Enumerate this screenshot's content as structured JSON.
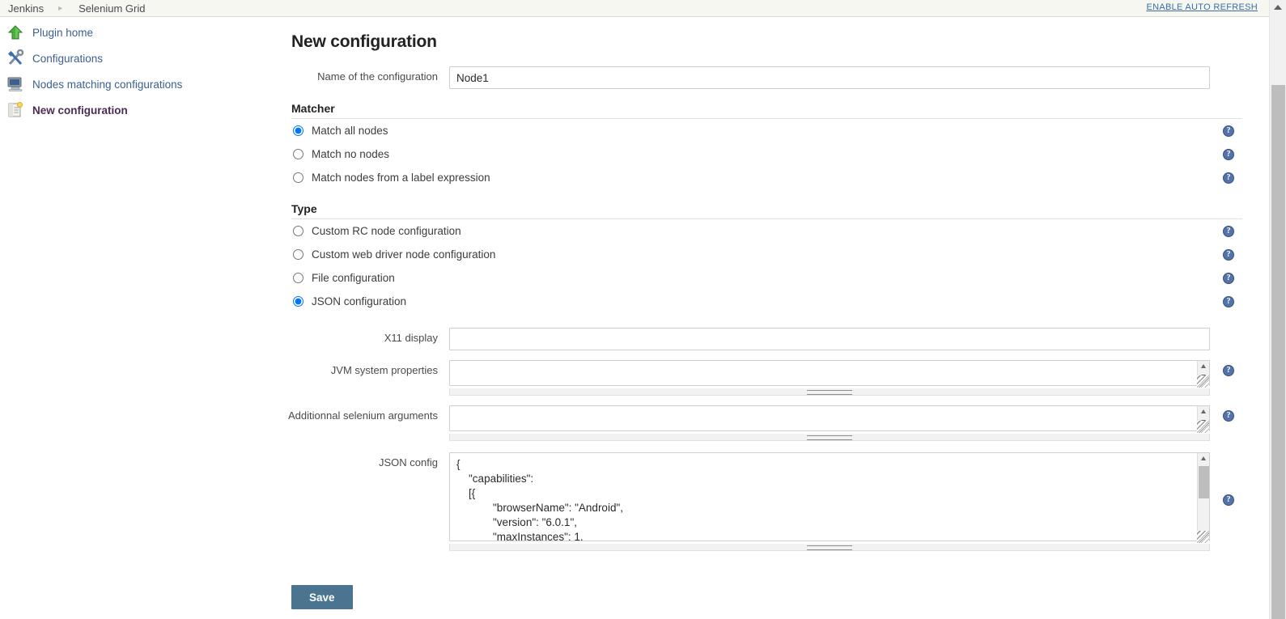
{
  "breadcrumb": {
    "items": [
      {
        "label": "Jenkins"
      },
      {
        "label": "Selenium Grid"
      }
    ],
    "separator": "▸",
    "auto_refresh_label": "ENABLE AUTO REFRESH"
  },
  "sidebar": {
    "items": [
      {
        "label": "Plugin home",
        "icon": "green-up-arrow-icon",
        "active": false
      },
      {
        "label": "Configurations",
        "icon": "tools-icon",
        "active": false
      },
      {
        "label": "Nodes matching configurations",
        "icon": "computer-icon",
        "active": false
      },
      {
        "label": "New configuration",
        "icon": "new-document-icon",
        "active": true
      }
    ]
  },
  "main": {
    "title": "New configuration",
    "name_field": {
      "label": "Name of the configuration",
      "value": "Node1",
      "placeholder": ""
    },
    "matcher": {
      "heading": "Matcher",
      "options": [
        {
          "label": "Match all nodes",
          "selected": true
        },
        {
          "label": "Match no nodes",
          "selected": false
        },
        {
          "label": "Match nodes from a label expression",
          "selected": false
        }
      ]
    },
    "type": {
      "heading": "Type",
      "options": [
        {
          "label": "Custom RC node configuration",
          "selected": false
        },
        {
          "label": "Custom web driver node configuration",
          "selected": false
        },
        {
          "label": "File configuration",
          "selected": false
        },
        {
          "label": "JSON configuration",
          "selected": true
        }
      ]
    },
    "fields": {
      "x11_display": {
        "label": "X11 display",
        "value": "",
        "placeholder": ""
      },
      "jvm_properties": {
        "label": "JVM system properties",
        "value": "",
        "placeholder": ""
      },
      "selenium_arguments": {
        "label": "Additionnal selenium arguments",
        "value": "",
        "placeholder": ""
      },
      "json_config": {
        "label": "JSON config",
        "value": "{\n    \"capabilities\":\n    [{\n            \"browserName\": \"Android\",\n            \"version\": \"6.0.1\",\n            \"maxInstances\": 1,"
      }
    },
    "save_label": "Save",
    "help_icon_glyph": "?"
  },
  "colors": {
    "breadcrumb_bg": "#f5f7f0",
    "link": "#3a5f8f",
    "active_item": "#4a2d55",
    "save_button": "#4a7490",
    "help_icon": "#5473a8"
  }
}
